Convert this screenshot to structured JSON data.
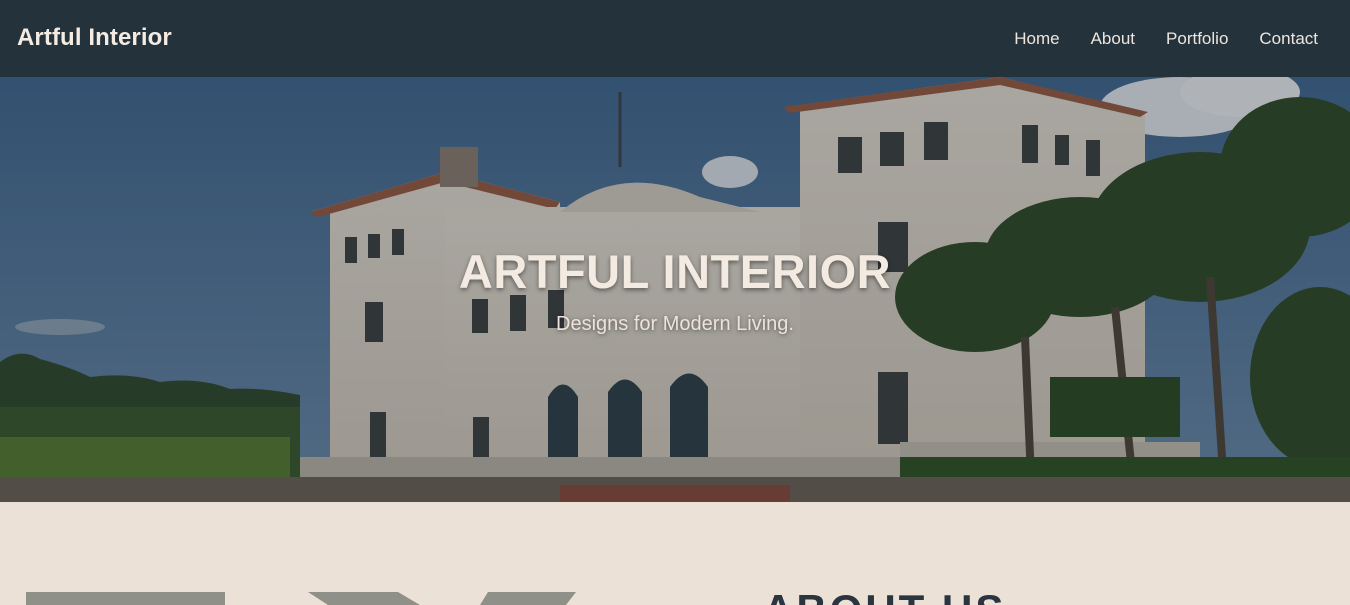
{
  "navbar": {
    "brand": "Artful Interior",
    "links": [
      "Home",
      "About",
      "Portfolio",
      "Contact"
    ]
  },
  "hero": {
    "title": "ARTFUL INTERIOR",
    "subtitle": "Designs for Modern Living."
  },
  "about": {
    "heading": "ABOUT US"
  },
  "colors": {
    "navbar_bg": "#24323c",
    "section_bg": "#ece1d6",
    "heading": "#2a3540",
    "hero_text": "#f3ebe2"
  }
}
